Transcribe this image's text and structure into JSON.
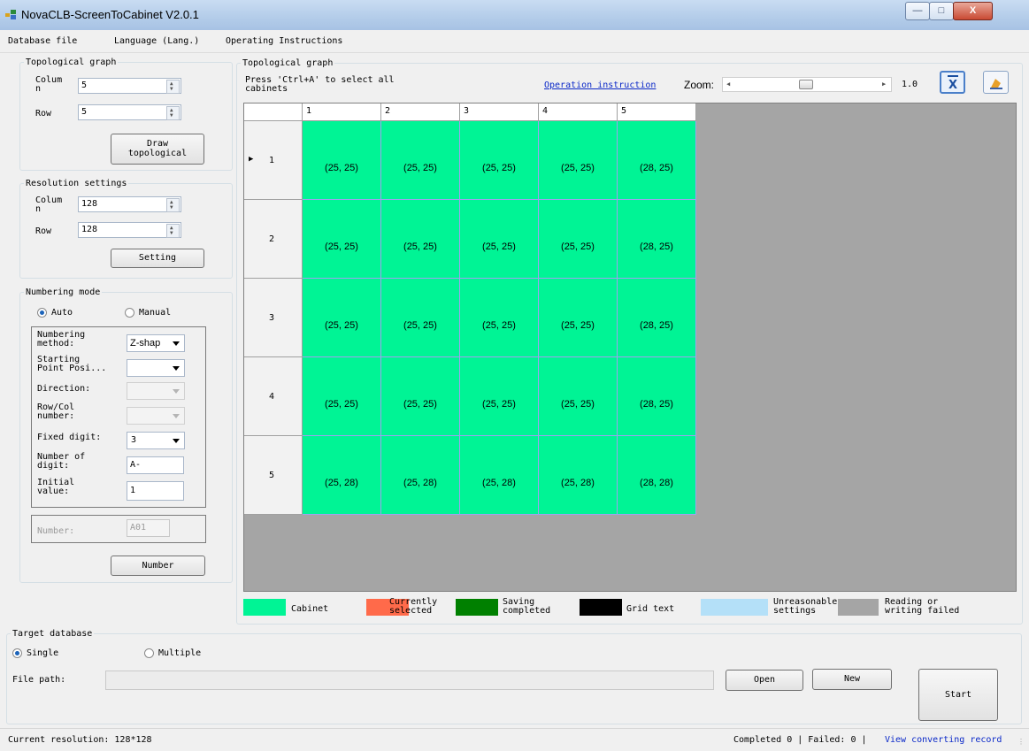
{
  "window": {
    "title": "NovaCLB-ScreenToCabinet V2.0.1",
    "min_icon": "minimize-icon",
    "max_icon": "maximize-icon",
    "close_glyph": "X"
  },
  "menu": [
    "Database file",
    "Language (Lang.)",
    "Operating Instructions"
  ],
  "topo_settings": {
    "legend": "Topological graph",
    "col_label": "Colum\nn",
    "row_label": "Row",
    "col_value": "5",
    "row_value": "5",
    "draw_button": "Draw\ntopological"
  },
  "resolution": {
    "legend": "Resolution settings",
    "col_label": "Colum\nn",
    "row_label": "Row",
    "col_value": "128",
    "row_value": "128",
    "setting_button": "Setting"
  },
  "numbering": {
    "legend": "Numbering mode",
    "auto": "Auto",
    "manual": "Manual",
    "method_label": "Numbering\nmethod:",
    "method_value": "Z-shap",
    "start_label": "Starting\nPoint Posi...",
    "direction_label": "Direction:",
    "rowcol_label": "Row/Col\nnumber:",
    "fixed_label": "Fixed digit:",
    "fixed_value": "3",
    "numdigit_label": "Number of\ndigit:",
    "numdigit_value": "A-",
    "initial_label": "Initial\nvalue:",
    "initial_value": "1",
    "number_label": "Number:",
    "number_value": "A01",
    "number_button": "Number"
  },
  "graph": {
    "legend": "Topological graph",
    "hint": "Press 'Ctrl+A' to select all\ncabinets",
    "op_link": "Operation instruction",
    "zoom_label": "Zoom:",
    "zoom_value": "1.0",
    "zoom_level": 0.5,
    "excel_icon": "excel-export-icon",
    "clear_icon": "eraser-icon",
    "columns": [
      "1",
      "2",
      "3",
      "4",
      "5"
    ],
    "rows": [
      "1",
      "2",
      "3",
      "4",
      "5"
    ],
    "current_row_marker": "▶",
    "cells": [
      [
        "(25, 25)",
        "(25, 25)",
        "(25, 25)",
        "(25, 25)",
        "(28, 25)"
      ],
      [
        "(25, 25)",
        "(25, 25)",
        "(25, 25)",
        "(25, 25)",
        "(28, 25)"
      ],
      [
        "(25, 25)",
        "(25, 25)",
        "(25, 25)",
        "(25, 25)",
        "(28, 25)"
      ],
      [
        "(25, 25)",
        "(25, 25)",
        "(25, 25)",
        "(25, 25)",
        "(28, 25)"
      ],
      [
        "(25, 28)",
        "(25, 28)",
        "(25, 28)",
        "(25, 28)",
        "(28, 28)"
      ]
    ]
  },
  "legend_items": [
    {
      "text": "Cabinet",
      "color": "#00f495"
    },
    {
      "text": "Currently\nselected",
      "color": "#ff6a4a"
    },
    {
      "text": "Saving\ncompleted",
      "color": "#008000"
    },
    {
      "text": "Grid text",
      "color": "#000000"
    },
    {
      "text": "Unreasonable\nsettings",
      "color": "#b4e0f8"
    },
    {
      "text": "Reading or\nwriting failed",
      "color": "#a5a5a5"
    }
  ],
  "target": {
    "legend": "Target database",
    "single": "Single",
    "multiple": "Multiple",
    "file_path_label": "File path:",
    "file_path_value": "",
    "open": "Open",
    "new": "New",
    "start": "Start"
  },
  "status": {
    "resolution": "Current resolution: 128*128",
    "counts": "Completed 0 | Failed: 0 |",
    "record_link": "View converting record"
  }
}
